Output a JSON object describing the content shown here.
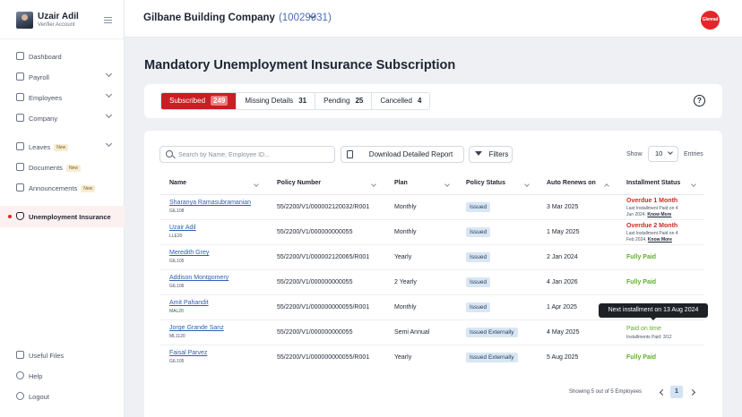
{
  "profile": {
    "name": "Uzair Adil",
    "role": "Verifier Account"
  },
  "sidebar": {
    "items": [
      {
        "label": "Dashboard",
        "icon": "dashboard-icon"
      },
      {
        "label": "Payroll",
        "icon": "payroll-icon",
        "expandable": true
      },
      {
        "label": "Employees",
        "icon": "employees-icon",
        "expandable": true
      },
      {
        "label": "Company",
        "icon": "company-icon",
        "expandable": true
      },
      {
        "label": "Leaves",
        "icon": "leaves-icon",
        "badge": "New",
        "expandable": true
      },
      {
        "label": "Documents",
        "icon": "documents-icon",
        "badge": "New"
      },
      {
        "label": "Announcements",
        "icon": "announcements-icon",
        "badge": "New"
      },
      {
        "label": "Unemployment Insurance",
        "icon": "shield-icon",
        "active": true
      }
    ],
    "bottom": [
      {
        "label": "Useful Files",
        "icon": "files-icon"
      },
      {
        "label": "Help",
        "icon": "help-icon"
      },
      {
        "label": "Logout",
        "icon": "logout-icon"
      }
    ]
  },
  "header": {
    "company": "Gilbane Building Company",
    "company_id": "(10029931)",
    "logo_text": "Glenrad"
  },
  "page": {
    "title": "Mandatory Unemployment Insurance Subscription"
  },
  "tabs": [
    {
      "label": "Subscribed",
      "count": "249",
      "active": true
    },
    {
      "label": "Missing Details",
      "count": "31"
    },
    {
      "label": "Pending",
      "count": "25"
    },
    {
      "label": "Cancelled",
      "count": "4"
    }
  ],
  "toolbar": {
    "search_placeholder": "Search by Name, Employee ID...",
    "download_label": "Download Detailed Report",
    "filters_label": "Filters",
    "show_label": "Show",
    "show_value": "10",
    "entries_label": "Entries"
  },
  "columns": [
    "Name",
    "Policy Number",
    "Plan",
    "Policy Status",
    "Auto Renews on",
    "Installment Status"
  ],
  "rows": [
    {
      "name": "Sharanya Ramasubramanian",
      "emp_id": "GIL108",
      "policy": "55/2200/V1/000002120032/R001",
      "plan": "Monthly",
      "status": "Issued",
      "renews": "3 Mar 2025",
      "inst_title": "Overdue 1 Month",
      "inst_type": "overdue",
      "inst_line1": "Last Installment Paid on 4",
      "inst_line2": "Jun 2024. ",
      "know": "Know More"
    },
    {
      "name": "Uzair Adil",
      "emp_id": "LLE20",
      "policy": "55/2200/V1/000000000055",
      "plan": "Monthly",
      "status": "Issued",
      "renews": "1 May 2025",
      "inst_title": "Overdue 2 Month",
      "inst_type": "overdue",
      "inst_line1": "Last Installment Paid on 4",
      "inst_line2": "Feb 2024. ",
      "know": "Know More"
    },
    {
      "name": "Meredith Grey",
      "emp_id": "GIL105",
      "policy": "55/2200/V1/000002120065/R001",
      "plan": "Yearly",
      "status": "Issued",
      "renews": "2 Jan 2024",
      "inst_title": "Fully Paid",
      "inst_type": "paid"
    },
    {
      "name": "Addison Montgomery",
      "emp_id": "GIL106",
      "policy": "55/2200/V1/000000000055",
      "plan": "2 Yearly",
      "status": "Issued",
      "renews": "4 Jan 2026",
      "inst_title": "Fully Paid",
      "inst_type": "paid"
    },
    {
      "name": "Amit Pahandit",
      "emp_id": "MAL20",
      "policy": "55/2200/V1/000000000055/R001",
      "plan": "Monthly",
      "status": "Issued",
      "renews": "1 Apr 2025",
      "inst_title": "",
      "inst_type": "none"
    },
    {
      "name": "Jorge Grande Sanz",
      "emp_id": "ML1120",
      "policy": "55/2200/V1/000000000055",
      "plan": "Semi Annual",
      "status": "Issued Externally",
      "renews": "4 May 2025",
      "inst_title": "Paid on time",
      "inst_type": "ontime",
      "inst_line1": "Installments Paid: 3/12"
    },
    {
      "name": "Faisal Parvez",
      "emp_id": "GIL105",
      "policy": "55/2200/V1/000000000055/R001",
      "plan": "Yearly",
      "status": "Issued Externally",
      "renews": "5 Aug 2025",
      "inst_title": "Fully Paid",
      "inst_type": "paid"
    }
  ],
  "tooltip": "Next installment on 13 Aug 2024",
  "pagination": {
    "summary": "Showing 5 out of 5 Employees",
    "page": "1"
  },
  "colors": {
    "accent": "#c91e24",
    "link": "#2f5fb3",
    "overdue": "#d12a24",
    "paid": "#5fae2e"
  }
}
